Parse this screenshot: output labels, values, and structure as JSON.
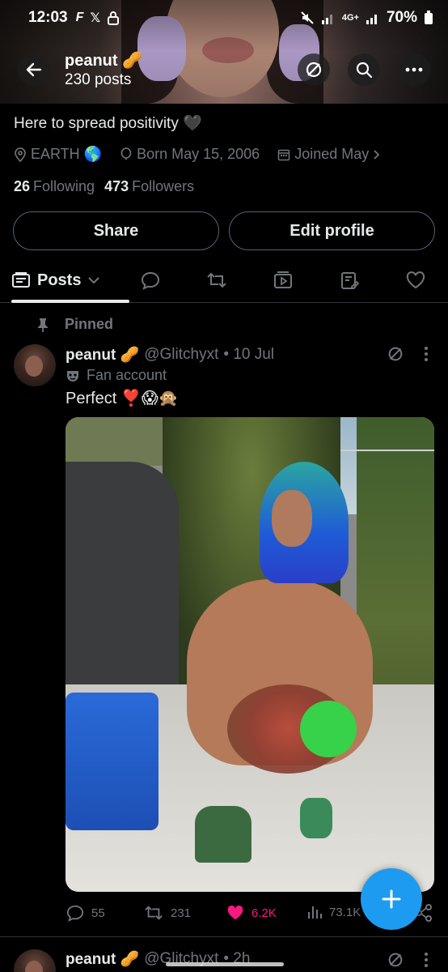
{
  "status_bar": {
    "time": "12:03",
    "network_label": "4G+",
    "battery": "70%"
  },
  "header": {
    "name": "peanut",
    "name_emoji": "🥜",
    "posts_count": "230 posts"
  },
  "profile": {
    "bio": "Here to spread positivity 🖤",
    "location": "EARTH 🌎",
    "born": "Born May 15, 2006",
    "joined": "Joined May",
    "following_count": "26",
    "following_label": "Following",
    "followers_count": "473",
    "followers_label": "Followers",
    "share_label": "Share",
    "edit_label": "Edit profile"
  },
  "tabs": {
    "posts_label": "Posts",
    "icons": [
      "chat-bubble-icon",
      "repost-icon",
      "video-icon",
      "article-icon",
      "heart-icon"
    ]
  },
  "pinned_label": "Pinned",
  "posts": [
    {
      "name": "peanut 🥜",
      "handle": "@Glitchyxt",
      "date": "• 10 Jul",
      "label": "Fan account",
      "text": "Perfect ❣️😱🙊",
      "reply_count": "55",
      "repost_count": "231",
      "like_count": "6.2K",
      "view_count": "73.1K"
    },
    {
      "name": "peanut 🥜",
      "handle": "@Glitchyxt",
      "date": "• 2h"
    }
  ],
  "colors": {
    "background": "#000000",
    "text": "#e7e9ea",
    "muted": "#71767b",
    "accent": "#1d9bf0",
    "like": "#f91880",
    "border": "#2f3336"
  }
}
